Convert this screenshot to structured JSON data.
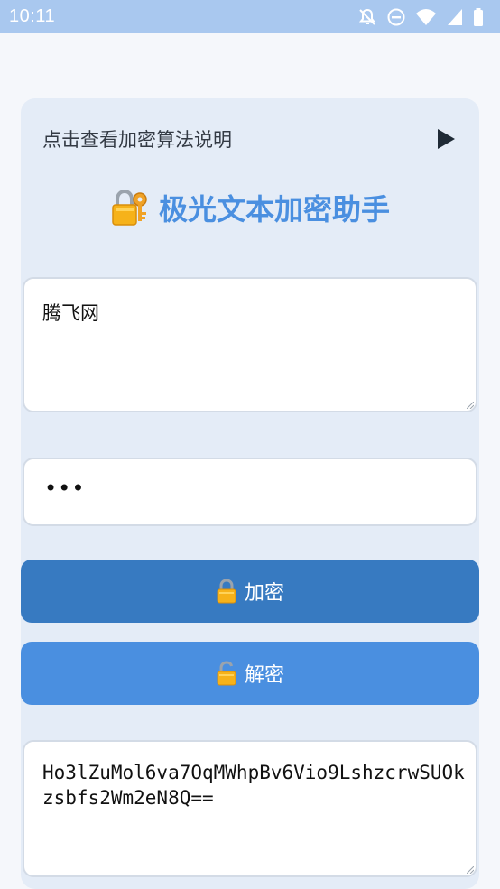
{
  "status_bar": {
    "time": "10:11",
    "icons": [
      "bell-off-icon",
      "do-not-disturb-icon",
      "wifi-icon",
      "signal-icon",
      "battery-icon"
    ]
  },
  "summary": {
    "label": "点击查看加密算法说明",
    "icon": "play-triangle-icon"
  },
  "title": {
    "text": "极光文本加密助手",
    "icon": "lock-with-key-icon",
    "color": "#4a8fe0"
  },
  "input_text": {
    "value": "腾飞网"
  },
  "password": {
    "masked_value": "•••"
  },
  "buttons": {
    "encrypt_label": "加密",
    "encrypt_icon": "locked-icon",
    "encrypt_color": "#377ac1",
    "decrypt_label": "解密",
    "decrypt_icon": "unlocked-icon",
    "decrypt_color": "#4a8fe0"
  },
  "output_text": {
    "value": "Ho3lZuMol6va7OqMWhpBv6Vio9LshzcrwSUOkzsbfs2Wm2eN8Q=="
  }
}
